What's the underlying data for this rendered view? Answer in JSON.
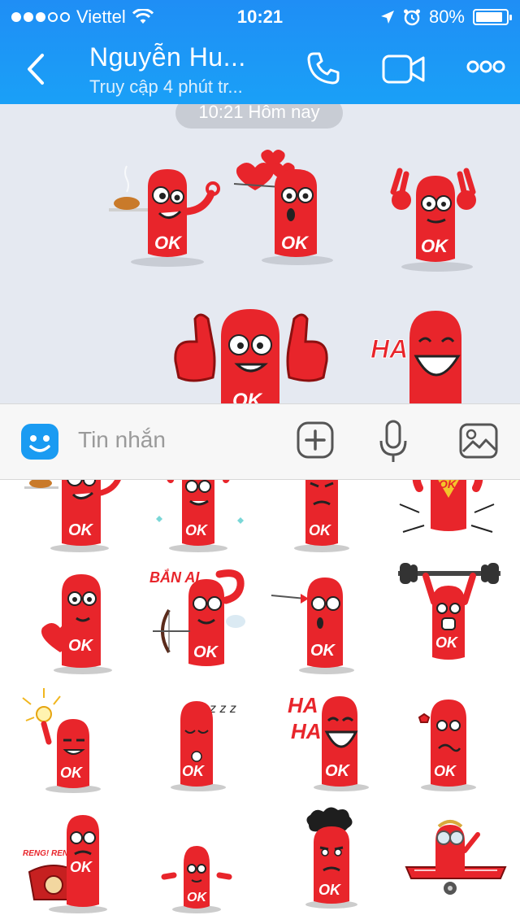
{
  "status_bar": {
    "carrier": "Viettel",
    "time": "10:21",
    "battery": "80%",
    "battery_level": 0.8,
    "signal_bars": 3,
    "signal_total": 5
  },
  "nav": {
    "title": "Nguyễn Hu...",
    "subtitle": "Truy cập 4 phút tr..."
  },
  "chat": {
    "date_label": "10:21 Hôm nay"
  },
  "composer": {
    "placeholder": "Tin nhắn"
  },
  "sticker_text": {
    "ok": "OK",
    "ha": "HA",
    "ban_ai": "BẮN AI",
    "reng": "RENG! RENG!",
    "zzz": "z z z"
  },
  "colors": {
    "header_blue": "#1f8ef5",
    "mascot_red": "#e8252b",
    "chat_bg": "#e5e9f1",
    "input_bg": "#f7f7f7"
  },
  "icons": {
    "back": "chevron-left-icon",
    "call": "phone-icon",
    "video": "video-camera-icon",
    "more": "more-dots-icon",
    "emoji": "emoji-icon",
    "add": "plus-circle-icon",
    "mic": "microphone-icon",
    "image": "image-icon"
  }
}
